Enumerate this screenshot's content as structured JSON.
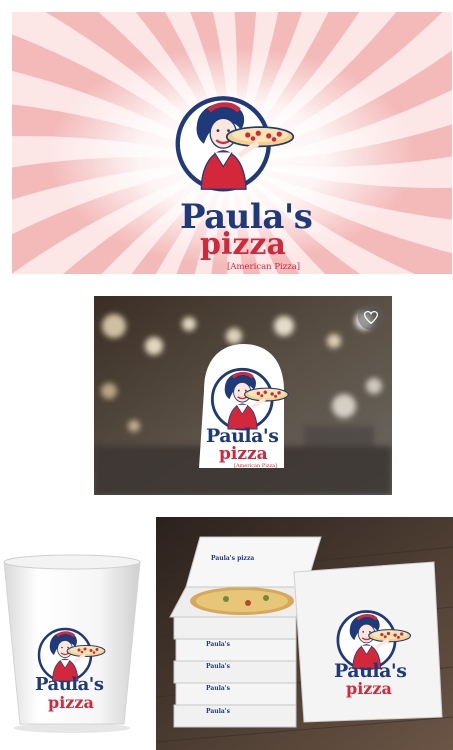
{
  "logo": {
    "name": "Paula's",
    "product": "pizza",
    "tagline": "[American Pizza]"
  },
  "colors": {
    "navy": "#1f3a7a",
    "red": "#d4283a",
    "pink_ray": "#f4b9b9"
  },
  "icons": {
    "favorite": "heart-icon"
  }
}
